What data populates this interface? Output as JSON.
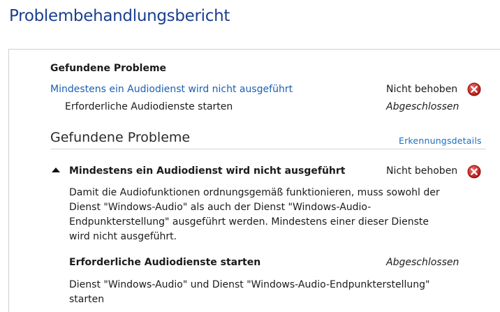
{
  "report": {
    "title": "Problembehandlungsbericht"
  },
  "summary": {
    "heading": "Gefundene Probleme",
    "problem": {
      "label": "Mindestens ein Audiodienst wird nicht ausgeführt",
      "status": "Nicht behoben",
      "icon": "error-icon"
    },
    "action": {
      "label": "Erforderliche Audiodienste starten",
      "status": "Abgeschlossen"
    }
  },
  "details": {
    "heading": "Gefundene Probleme",
    "details_link": "Erkennungsdetails",
    "problem": {
      "label": "Mindestens ein Audiodienst wird nicht ausgeführt",
      "status": "Nicht behoben",
      "icon": "error-icon",
      "expand_icon": "caret-up-icon",
      "description": "Damit die Audiofunktionen ordnungsgemäß funktionieren, muss sowohl der Dienst \"Windows-Audio\" als auch der Dienst \"Windows-Audio-Endpunkterstellung\" ausgeführt werden. Mindestens einer dieser Dienste wird nicht ausgeführt."
    },
    "action": {
      "label": "Erforderliche Audiodienste starten",
      "status": "Abgeschlossen",
      "description": "Dienst \"Windows-Audio\" und Dienst \"Windows-Audio-Endpunkterstellung\" starten"
    }
  },
  "colors": {
    "title": "#1b3f8f",
    "link": "#1a5fb4",
    "error_red": "#c42b1c"
  }
}
